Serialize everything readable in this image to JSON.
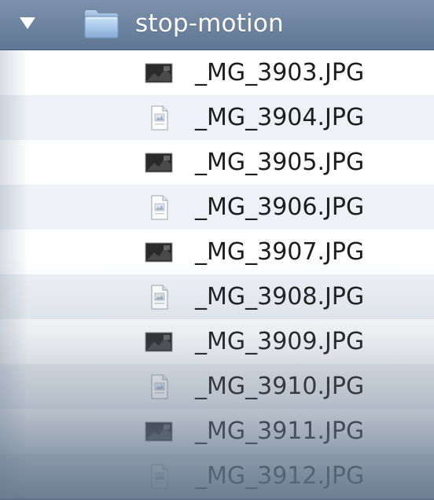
{
  "folder": {
    "name": "stop-motion",
    "expanded": true,
    "icon": "folder-icon",
    "color": "#8fb1d6"
  },
  "files": [
    {
      "name": "_MG_3903.JPG",
      "icon": "image-thumbnail-icon"
    },
    {
      "name": "_MG_3904.JPG",
      "icon": "document-icon"
    },
    {
      "name": "_MG_3905.JPG",
      "icon": "image-thumbnail-icon"
    },
    {
      "name": "_MG_3906.JPG",
      "icon": "document-icon"
    },
    {
      "name": "_MG_3907.JPG",
      "icon": "image-thumbnail-icon"
    },
    {
      "name": "_MG_3908.JPG",
      "icon": "document-icon"
    },
    {
      "name": "_MG_3909.JPG",
      "icon": "image-thumbnail-icon"
    },
    {
      "name": "_MG_3910.JPG",
      "icon": "document-icon"
    },
    {
      "name": "_MG_3911.JPG",
      "icon": "image-thumbnail-icon"
    },
    {
      "name": "_MG_3912.JPG",
      "icon": "document-icon"
    }
  ],
  "colors": {
    "header_background": "#6d84a0",
    "row_odd": "#ffffff",
    "row_even": "#eef1f5",
    "text": "#1d1d1d"
  }
}
